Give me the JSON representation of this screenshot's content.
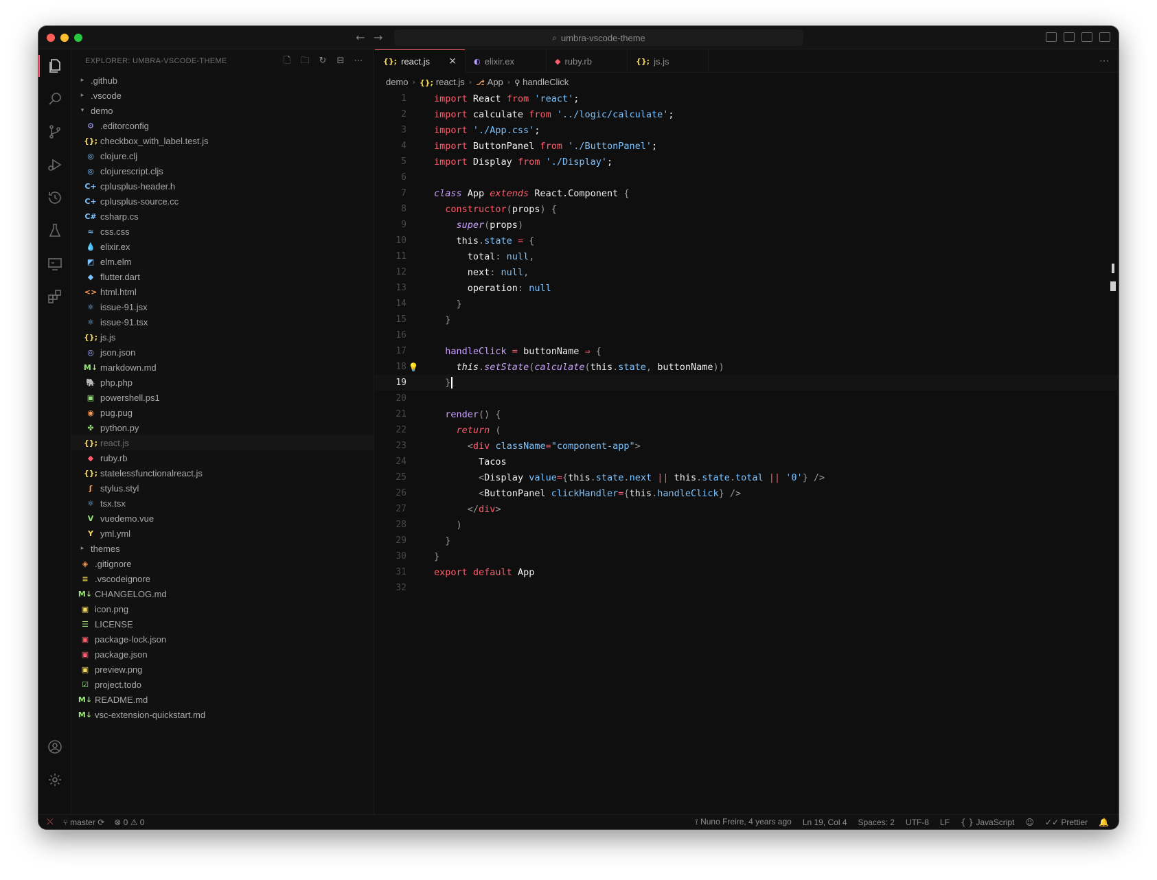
{
  "titlebar": {
    "search_text": "umbra-vscode-theme"
  },
  "explorer": {
    "title": "EXPLORER: UMBRA-VSCODE-THEME",
    "items": [
      {
        "label": ".github",
        "type": "folder",
        "open": false,
        "depth": 0
      },
      {
        "label": ".vscode",
        "type": "folder",
        "open": false,
        "depth": 0
      },
      {
        "label": "demo",
        "type": "folder",
        "open": true,
        "depth": 0
      },
      {
        "label": ".editorconfig",
        "icon": "gear-icon",
        "glyph": "⚙",
        "color": "#a9a9ff",
        "depth": 1
      },
      {
        "label": "checkbox_with_label.test.js",
        "icon": "js-icon",
        "glyph": "{};",
        "color": "#f5d75b",
        "depth": 1
      },
      {
        "label": "clojure.clj",
        "icon": "clojure-icon",
        "glyph": "◎",
        "color": "#7cc3ff",
        "depth": 1
      },
      {
        "label": "clojurescript.cljs",
        "icon": "clojurescript-icon",
        "glyph": "◎",
        "color": "#7cc3ff",
        "depth": 1
      },
      {
        "label": "cplusplus-header.h",
        "icon": "cpp-icon",
        "glyph": "C+",
        "color": "#7cc3ff",
        "depth": 1
      },
      {
        "label": "cplusplus-source.cc",
        "icon": "cpp-icon",
        "glyph": "C+",
        "color": "#7cc3ff",
        "depth": 1
      },
      {
        "label": "csharp.cs",
        "icon": "csharp-icon",
        "glyph": "C#",
        "color": "#7cc3ff",
        "depth": 1
      },
      {
        "label": "css.css",
        "icon": "css-icon",
        "glyph": "≈",
        "color": "#7cc3ff",
        "depth": 1
      },
      {
        "label": "elixir.ex",
        "icon": "elixir-icon",
        "glyph": "💧",
        "color": "#b395ff",
        "depth": 1
      },
      {
        "label": "elm.elm",
        "icon": "elm-icon",
        "glyph": "◩",
        "color": "#7cc3ff",
        "depth": 1
      },
      {
        "label": "flutter.dart",
        "icon": "dart-icon",
        "glyph": "◆",
        "color": "#7cc3ff",
        "depth": 1
      },
      {
        "label": "html.html",
        "icon": "html-icon",
        "glyph": "<>",
        "color": "#ff9a52",
        "depth": 1
      },
      {
        "label": "issue-91.jsx",
        "icon": "react-icon",
        "glyph": "⚛",
        "color": "#7cc3ff",
        "depth": 1
      },
      {
        "label": "issue-91.tsx",
        "icon": "react-icon",
        "glyph": "⚛",
        "color": "#7cc3ff",
        "depth": 1
      },
      {
        "label": "js.js",
        "icon": "js-icon",
        "glyph": "{};",
        "color": "#f5d75b",
        "depth": 1
      },
      {
        "label": "json.json",
        "icon": "json-icon",
        "glyph": "◎",
        "color": "#a9a9ff",
        "depth": 1
      },
      {
        "label": "markdown.md",
        "icon": "markdown-icon",
        "glyph": "M↓",
        "color": "#9be37b",
        "depth": 1
      },
      {
        "label": "php.php",
        "icon": "php-icon",
        "glyph": "🐘",
        "color": "#7cc3ff",
        "depth": 1
      },
      {
        "label": "powershell.ps1",
        "icon": "powershell-icon",
        "glyph": "▣",
        "color": "#9be37b",
        "depth": 1
      },
      {
        "label": "pug.pug",
        "icon": "pug-icon",
        "glyph": "◉",
        "color": "#ff9a52",
        "depth": 1
      },
      {
        "label": "python.py",
        "icon": "python-icon",
        "glyph": "✤",
        "color": "#9be37b",
        "depth": 1
      },
      {
        "label": "react.js",
        "icon": "js-icon",
        "glyph": "{};",
        "color": "#f5d75b",
        "depth": 1,
        "selected": true
      },
      {
        "label": "ruby.rb",
        "icon": "ruby-icon",
        "glyph": "◆",
        "color": "#ff5c6c",
        "depth": 1
      },
      {
        "label": "statelessfunctionalreact.js",
        "icon": "js-icon",
        "glyph": "{};",
        "color": "#f5d75b",
        "depth": 1
      },
      {
        "label": "stylus.styl",
        "icon": "stylus-icon",
        "glyph": "ʃ",
        "color": "#ff9a52",
        "depth": 1
      },
      {
        "label": "tsx.tsx",
        "icon": "react-icon",
        "glyph": "⚛",
        "color": "#7cc3ff",
        "depth": 1
      },
      {
        "label": "vuedemo.vue",
        "icon": "vue-icon",
        "glyph": "V",
        "color": "#9be37b",
        "depth": 1
      },
      {
        "label": "yml.yml",
        "icon": "yaml-icon",
        "glyph": "Y",
        "color": "#f5d75b",
        "depth": 1
      },
      {
        "label": "themes",
        "type": "folder",
        "open": false,
        "depth": 0
      },
      {
        "label": ".gitignore",
        "icon": "git-icon",
        "glyph": "◈",
        "color": "#ff9a52",
        "depth": 0,
        "file": true
      },
      {
        "label": ".vscodeignore",
        "icon": "lines-icon",
        "glyph": "≡",
        "color": "#f5d75b",
        "depth": 0,
        "file": true
      },
      {
        "label": "CHANGELOG.md",
        "icon": "markdown-icon",
        "glyph": "M↓",
        "color": "#9be37b",
        "depth": 0,
        "file": true
      },
      {
        "label": "icon.png",
        "icon": "image-icon",
        "glyph": "▣",
        "color": "#f5d75b",
        "depth": 0,
        "file": true
      },
      {
        "label": "LICENSE",
        "icon": "license-icon",
        "glyph": "☰",
        "color": "#9be37b",
        "depth": 0,
        "file": true
      },
      {
        "label": "package-lock.json",
        "icon": "npm-icon",
        "glyph": "▣",
        "color": "#ff5c6c",
        "depth": 0,
        "file": true
      },
      {
        "label": "package.json",
        "icon": "npm-icon",
        "glyph": "▣",
        "color": "#ff5c6c",
        "depth": 0,
        "file": true
      },
      {
        "label": "preview.png",
        "icon": "image-icon",
        "glyph": "▣",
        "color": "#f5d75b",
        "depth": 0,
        "file": true
      },
      {
        "label": "project.todo",
        "icon": "todo-icon",
        "glyph": "☑",
        "color": "#9be37b",
        "depth": 0,
        "file": true
      },
      {
        "label": "README.md",
        "icon": "markdown-icon",
        "glyph": "M↓",
        "color": "#9be37b",
        "depth": 0,
        "file": true
      },
      {
        "label": "vsc-extension-quickstart.md",
        "icon": "markdown-icon",
        "glyph": "M↓",
        "color": "#9be37b",
        "depth": 0,
        "file": true
      }
    ]
  },
  "tabs": [
    {
      "label": "react.js",
      "icon": "js-icon",
      "glyph": "{};",
      "color": "#f5d75b",
      "active": true
    },
    {
      "label": "elixir.ex",
      "icon": "elixir-icon",
      "glyph": "◐",
      "color": "#b395ff"
    },
    {
      "label": "ruby.rb",
      "icon": "ruby-icon",
      "glyph": "◆",
      "color": "#ff5c6c"
    },
    {
      "label": "js.js",
      "icon": "js-icon",
      "glyph": "{};",
      "color": "#f5d75b"
    }
  ],
  "breadcrumb": [
    "demo",
    "react.js",
    "App",
    "handleClick"
  ],
  "editor": {
    "current_line": 19,
    "lines": [
      [
        [
          "k",
          "import"
        ],
        [
          "v",
          " React "
        ],
        [
          "k",
          "from"
        ],
        [
          "s",
          " 'react'"
        ],
        [
          "v",
          ";"
        ]
      ],
      [
        [
          "k",
          "import"
        ],
        [
          "v",
          " calculate "
        ],
        [
          "k",
          "from"
        ],
        [
          "s",
          " '../logic/calculate'"
        ],
        [
          "v",
          ";"
        ]
      ],
      [
        [
          "k",
          "import"
        ],
        [
          "s",
          " './App.css'"
        ],
        [
          "v",
          ";"
        ]
      ],
      [
        [
          "k",
          "import"
        ],
        [
          "v",
          " ButtonPanel "
        ],
        [
          "k",
          "from"
        ],
        [
          "s",
          " './ButtonPanel'"
        ],
        [
          "v",
          ";"
        ]
      ],
      [
        [
          "k",
          "import"
        ],
        [
          "v",
          " Display "
        ],
        [
          "k",
          "from"
        ],
        [
          "s",
          " './Display'"
        ],
        [
          "v",
          ";"
        ]
      ],
      [],
      [
        [
          "fi",
          "class"
        ],
        [
          "v",
          " App "
        ],
        [
          "ki",
          "extends"
        ],
        [
          "v",
          " React.Component "
        ],
        [
          "pn",
          "{"
        ]
      ],
      [
        [
          "v",
          "  "
        ],
        [
          "k",
          "constructor"
        ],
        [
          "pn",
          "("
        ],
        [
          "v",
          "props"
        ],
        [
          "pn",
          ") {"
        ]
      ],
      [
        [
          "v",
          "    "
        ],
        [
          "fi",
          "super"
        ],
        [
          "pn",
          "("
        ],
        [
          "v",
          "props"
        ],
        [
          "pn",
          ")"
        ]
      ],
      [
        [
          "v",
          "    this"
        ],
        [
          "pn",
          "."
        ],
        [
          "p",
          "state"
        ],
        [
          "op",
          " = "
        ],
        [
          "pn",
          "{"
        ]
      ],
      [
        [
          "v",
          "      total"
        ],
        [
          "pn",
          ": "
        ],
        [
          "p",
          "null"
        ],
        [
          "pn",
          ","
        ]
      ],
      [
        [
          "v",
          "      next"
        ],
        [
          "pn",
          ": "
        ],
        [
          "p",
          "null"
        ],
        [
          "pn",
          ","
        ]
      ],
      [
        [
          "v",
          "      operation"
        ],
        [
          "pn",
          ": "
        ],
        [
          "p",
          "null"
        ]
      ],
      [
        [
          "pn",
          "    }"
        ]
      ],
      [
        [
          "pn",
          "  }"
        ]
      ],
      [],
      [
        [
          "v",
          "  "
        ],
        [
          "f",
          "handleClick"
        ],
        [
          "op",
          " = "
        ],
        [
          "v",
          "buttonName "
        ],
        [
          "op",
          "⇒"
        ],
        [
          "pn",
          " {"
        ]
      ],
      [
        [
          "v",
          "    "
        ],
        [
          "th",
          "this"
        ],
        [
          "pn",
          "."
        ],
        [
          "fi",
          "setState"
        ],
        [
          "pn",
          "("
        ],
        [
          "fi",
          "calculate"
        ],
        [
          "pn",
          "("
        ],
        [
          "v",
          "this"
        ],
        [
          "pn",
          "."
        ],
        [
          "p",
          "state"
        ],
        [
          "pn",
          ", "
        ],
        [
          "v",
          "buttonName"
        ],
        [
          "pn",
          "))"
        ]
      ],
      [
        [
          "pn",
          "  }"
        ]
      ],
      [],
      [
        [
          "v",
          "  "
        ],
        [
          "f",
          "render"
        ],
        [
          "pn",
          "() {"
        ]
      ],
      [
        [
          "v",
          "    "
        ],
        [
          "ki",
          "return"
        ],
        [
          "pn",
          " ("
        ]
      ],
      [
        [
          "v",
          "      "
        ],
        [
          "pn",
          "<"
        ],
        [
          "k",
          "div"
        ],
        [
          "p",
          " className"
        ],
        [
          "op",
          "="
        ],
        [
          "s",
          "\"component-app\""
        ],
        [
          "pn",
          ">"
        ]
      ],
      [
        [
          "v",
          "        Tacos"
        ]
      ],
      [
        [
          "v",
          "        "
        ],
        [
          "pn",
          "<"
        ],
        [
          "v",
          "Display "
        ],
        [
          "p",
          "value"
        ],
        [
          "op",
          "="
        ],
        [
          "pn",
          "{"
        ],
        [
          "v",
          "this"
        ],
        [
          "pn",
          "."
        ],
        [
          "p",
          "state"
        ],
        [
          "pn",
          "."
        ],
        [
          "p",
          "next"
        ],
        [
          "op",
          " || "
        ],
        [
          "v",
          "this"
        ],
        [
          "pn",
          "."
        ],
        [
          "p",
          "state"
        ],
        [
          "pn",
          "."
        ],
        [
          "p",
          "total"
        ],
        [
          "op",
          " || "
        ],
        [
          "s",
          "'0'"
        ],
        [
          "pn",
          "} />"
        ]
      ],
      [
        [
          "v",
          "        "
        ],
        [
          "pn",
          "<"
        ],
        [
          "v",
          "ButtonPanel "
        ],
        [
          "p",
          "clickHandler"
        ],
        [
          "op",
          "="
        ],
        [
          "pn",
          "{"
        ],
        [
          "v",
          "this"
        ],
        [
          "pn",
          "."
        ],
        [
          "p",
          "handleClick"
        ],
        [
          "pn",
          "} />"
        ]
      ],
      [
        [
          "v",
          "      "
        ],
        [
          "pn",
          "</"
        ],
        [
          "k",
          "div"
        ],
        [
          "pn",
          ">"
        ]
      ],
      [
        [
          "pn",
          "    )"
        ]
      ],
      [
        [
          "pn",
          "  }"
        ]
      ],
      [
        [
          "pn",
          "}"
        ]
      ],
      [
        [
          "k",
          "export"
        ],
        [
          "k",
          " default"
        ],
        [
          "v",
          " App"
        ]
      ],
      []
    ]
  },
  "statusbar": {
    "branch": "master",
    "errors": "0",
    "warnings": "0",
    "blame": "Nuno Freire, 4 years ago",
    "position": "Ln 19, Col 4",
    "spaces": "Spaces: 2",
    "encoding": "UTF-8",
    "eol": "LF",
    "language": "JavaScript",
    "formatter": "Prettier"
  }
}
